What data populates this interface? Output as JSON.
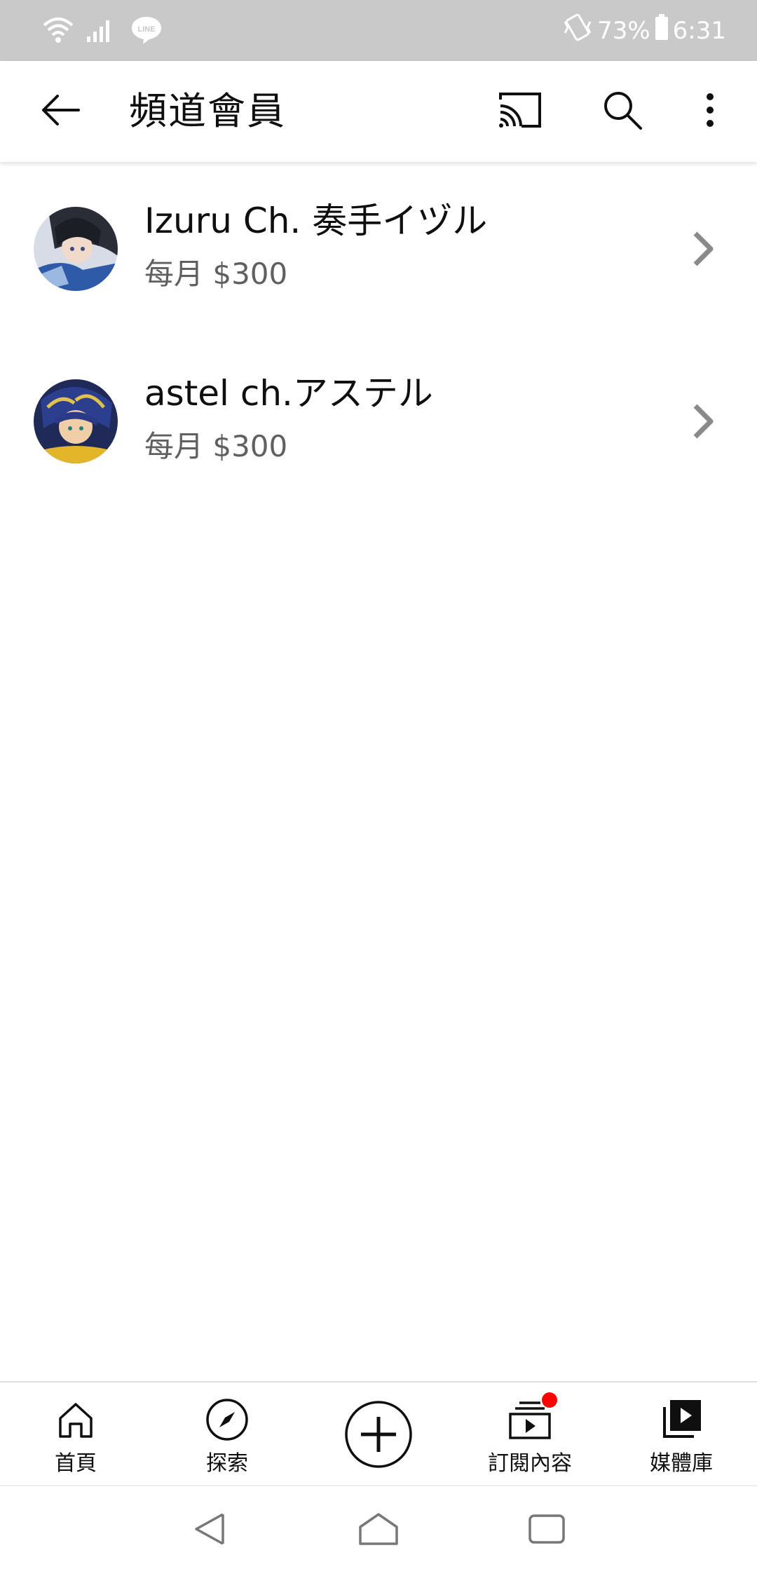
{
  "status_bar": {
    "battery": "73%",
    "time": "6:31",
    "line_app_text": "LINE",
    "icons": [
      "wifi-icon",
      "signal-icon",
      "line-app-icon",
      "vibrate-icon",
      "battery-icon"
    ]
  },
  "app_bar": {
    "title": "頻道會員",
    "icons": [
      "back-arrow-icon",
      "cast-icon",
      "search-icon",
      "more-vert-icon"
    ]
  },
  "members": [
    {
      "channel": "Izuru Ch. 奏手イヅル",
      "price": "每月 $300"
    },
    {
      "channel": "astel ch.アステル",
      "price": "每月 $300"
    }
  ],
  "bottom_nav": {
    "items": [
      {
        "label": "首頁",
        "icon": "home-icon"
      },
      {
        "label": "探索",
        "icon": "explore-icon"
      },
      {
        "label": "",
        "icon": "create-plus-icon"
      },
      {
        "label": "訂閱內容",
        "icon": "subscriptions-icon"
      },
      {
        "label": "媒體庫",
        "icon": "library-icon"
      }
    ],
    "notification_color": "#ff0000"
  },
  "system_nav": [
    "back-triangle-icon",
    "home-pentagon-icon",
    "recents-icon"
  ]
}
